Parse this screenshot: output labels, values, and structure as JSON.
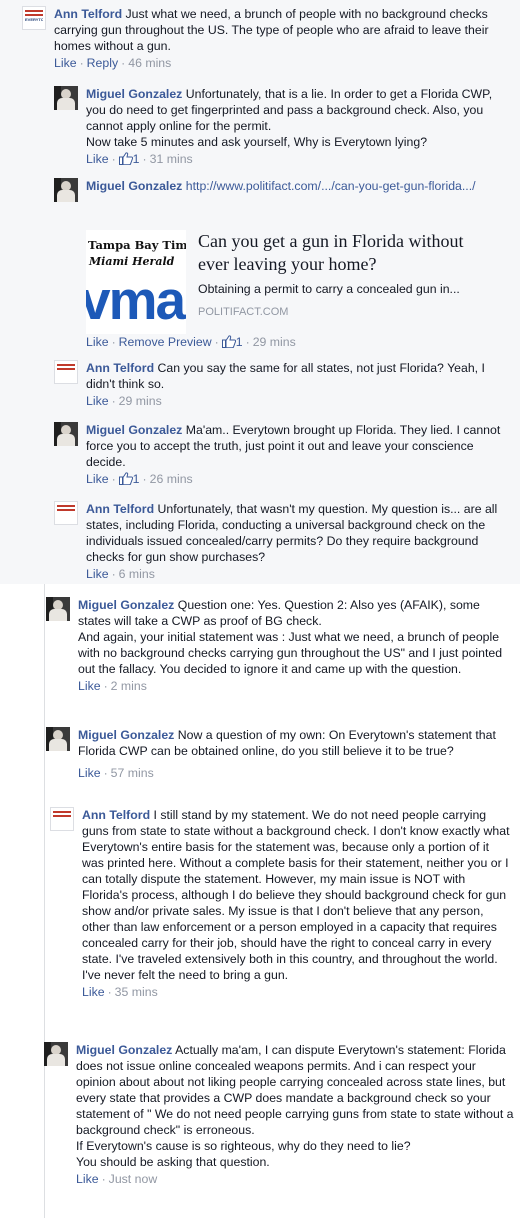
{
  "comments": [
    {
      "author": "Ann Telford",
      "text": "Just what we need, a brunch of people with no background checks carrying gun throughout the US. The type of people who are afraid to leave their homes without a gun.",
      "actions": [
        "Like",
        "Reply"
      ],
      "time": "46 mins"
    },
    {
      "author": "Miguel Gonzalez",
      "text": "Unfortunately, that is a lie. In order to get a Florida CWP, you do need to get fingerprinted and pass a background check. Also, you cannot apply online for the permit.\nNow take 5 minutes and ask yourself, Why is Everytown lying?",
      "actions": [
        "Like"
      ],
      "likes": "1",
      "time": "31 mins"
    },
    {
      "author": "Miguel Gonzalez",
      "link": "http://www.politifact.com/.../can-you-get-gun-florida.../",
      "actions": [
        "Like",
        "Remove Preview"
      ],
      "likes": "1",
      "time": "29 mins"
    },
    {
      "author": "Ann Telford",
      "text": "Can you say the same for all states, not just Florida? Yeah, I didn't think so.",
      "actions": [
        "Like"
      ],
      "time": "29 mins"
    },
    {
      "author": "Miguel Gonzalez",
      "text": "Ma'am.. Everytown brought up Florida. They lied. I cannot force you to accept the truth, just point it out and leave your conscience decide.",
      "actions": [
        "Like"
      ],
      "likes": "1",
      "time": "26 mins"
    },
    {
      "author": "Ann Telford",
      "text": "Unfortunately, that wasn't my question. My question is... are all states, including Florida, conducting a universal background check on the individuals issued concealed/carry permits? Do they require background checks for gun show purchases?",
      "actions": [
        "Like"
      ],
      "time": "6 mins"
    },
    {
      "author": "Miguel Gonzalez",
      "text": "Question one: Yes. Question 2: Also yes (AFAIK), some states will take a CWP as proof of BG check.\nAnd again, your initial statement was : Just what we need, a brunch of people with no background checks carrying gun throughout the US\" and I just pointed out the fallacy. You decided to ignore it and came up with the question.",
      "actions": [
        "Like"
      ],
      "time": "2 mins"
    },
    {
      "author": "Miguel Gonzalez",
      "text": "Now a question of my own: On Everytown's statement that Florida CWP can be obtained online, do you still believe it to be true?",
      "actions": [
        "Like"
      ],
      "time": "57 mins"
    },
    {
      "author": "Ann Telford",
      "text": "I still stand by my statement. We do not need people carrying guns from state to state without a background check. I don't know exactly what Everytown's entire basis for the statement was, because only a portion of it was printed here. Without a complete basis for their statement, neither you or I can totally dispute the statement. However, my main issue is NOT with Florida's process, although I do believe they should background check for gun show and/or private sales. My issue is that I don't believe that any person, other than law enforcement or a person employed in a capacity that requires concealed carry for their job, should have the right to conceal carry in every state. I've traveled extensively both in this country, and throughout the world. I've never felt the need to bring a gun.",
      "actions": [
        "Like"
      ],
      "time": "35 mins"
    },
    {
      "author": "Miguel Gonzalez",
      "text": "Actually ma'am, I can dispute Everytown's statement: Florida does not issue online concealed weapons permits. And i can respect your opinion about about not liking people carrying concealed across state lines, but every state that provides a CWP does mandate a background check so your statement of \" We do not need people carrying guns from state to state without a background check\" is erroneous.\nIf Everytown's cause is so righteous, why do they need to lie?\nYou should be asking that question.",
      "actions": [
        "Like"
      ],
      "time": "Just now"
    }
  ],
  "preview": {
    "logo_line1": "Tampa Bay Times",
    "logo_line2": "Miami Herald",
    "logo_big": "vma",
    "title": "Can you get a gun in Florida without ever leaving your home?",
    "description": "Obtaining a permit to carry a concealed gun in...",
    "host": "POLITIFACT.COM"
  },
  "avatar_caption": "EVERYTOWN",
  "colors": {
    "link": "#3b5998",
    "meta": "#9197a3",
    "thread_bg": "#f6f7f9"
  }
}
